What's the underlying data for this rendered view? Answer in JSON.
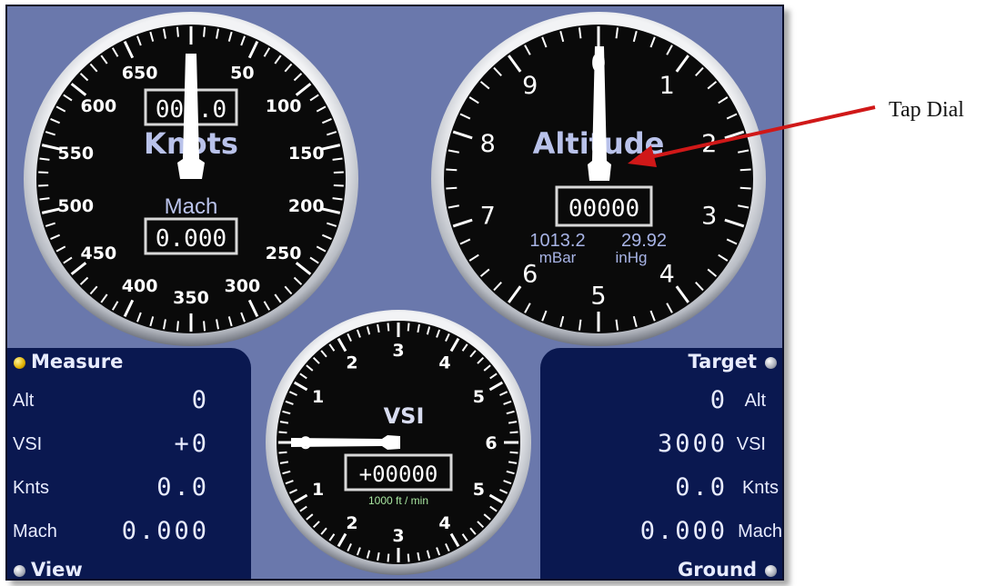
{
  "knots_gauge": {
    "scale": [
      "0",
      "50",
      "100",
      "150",
      "200",
      "250",
      "300",
      "350",
      "400",
      "450",
      "500",
      "550",
      "600",
      "650"
    ],
    "title": "Knots",
    "readout": "00 .0",
    "sub_title": "Mach",
    "sub_readout": "0.000"
  },
  "altitude_gauge": {
    "scale": [
      "0",
      "1",
      "2",
      "3",
      "4",
      "5",
      "6",
      "7",
      "8",
      "9"
    ],
    "title": "Altitude",
    "readout": "00000",
    "pressure_mbar": "1013.2",
    "pressure_inhg": "29.92",
    "unit_mbar": "mBar",
    "unit_inhg": "inHg"
  },
  "vsi_gauge": {
    "scale_top": [
      "3",
      "4",
      "5",
      "6",
      "5",
      "4",
      "3",
      "2",
      "1",
      "0",
      "1",
      "2"
    ],
    "title": "VSI",
    "readout": "+00000",
    "unit": "1000 ft / min"
  },
  "measure": {
    "header": "Measure",
    "footer": "View",
    "rows": [
      {
        "label": "Alt",
        "value": "0"
      },
      {
        "label": "VSI",
        "value": "+0"
      },
      {
        "label": "Knts",
        "value": "0.0"
      },
      {
        "label": "Mach",
        "value": "0.000"
      }
    ]
  },
  "target": {
    "header": "Target",
    "footer": "Ground",
    "rows": [
      {
        "label": "Alt",
        "value": "0"
      },
      {
        "label": "VSI",
        "value": "3000"
      },
      {
        "label": "Knts",
        "value": "0.0"
      },
      {
        "label": "Mach",
        "value": "0.000"
      }
    ]
  },
  "annotation": {
    "label": "Tap Dial"
  },
  "colors": {
    "panel": "#6a78ac",
    "subpanel": "#0a1850",
    "dial_face": "#0a0a0a",
    "bezel": "#d8dade",
    "indicator_yellow": "#e0b000",
    "arrow": "#d01818"
  }
}
